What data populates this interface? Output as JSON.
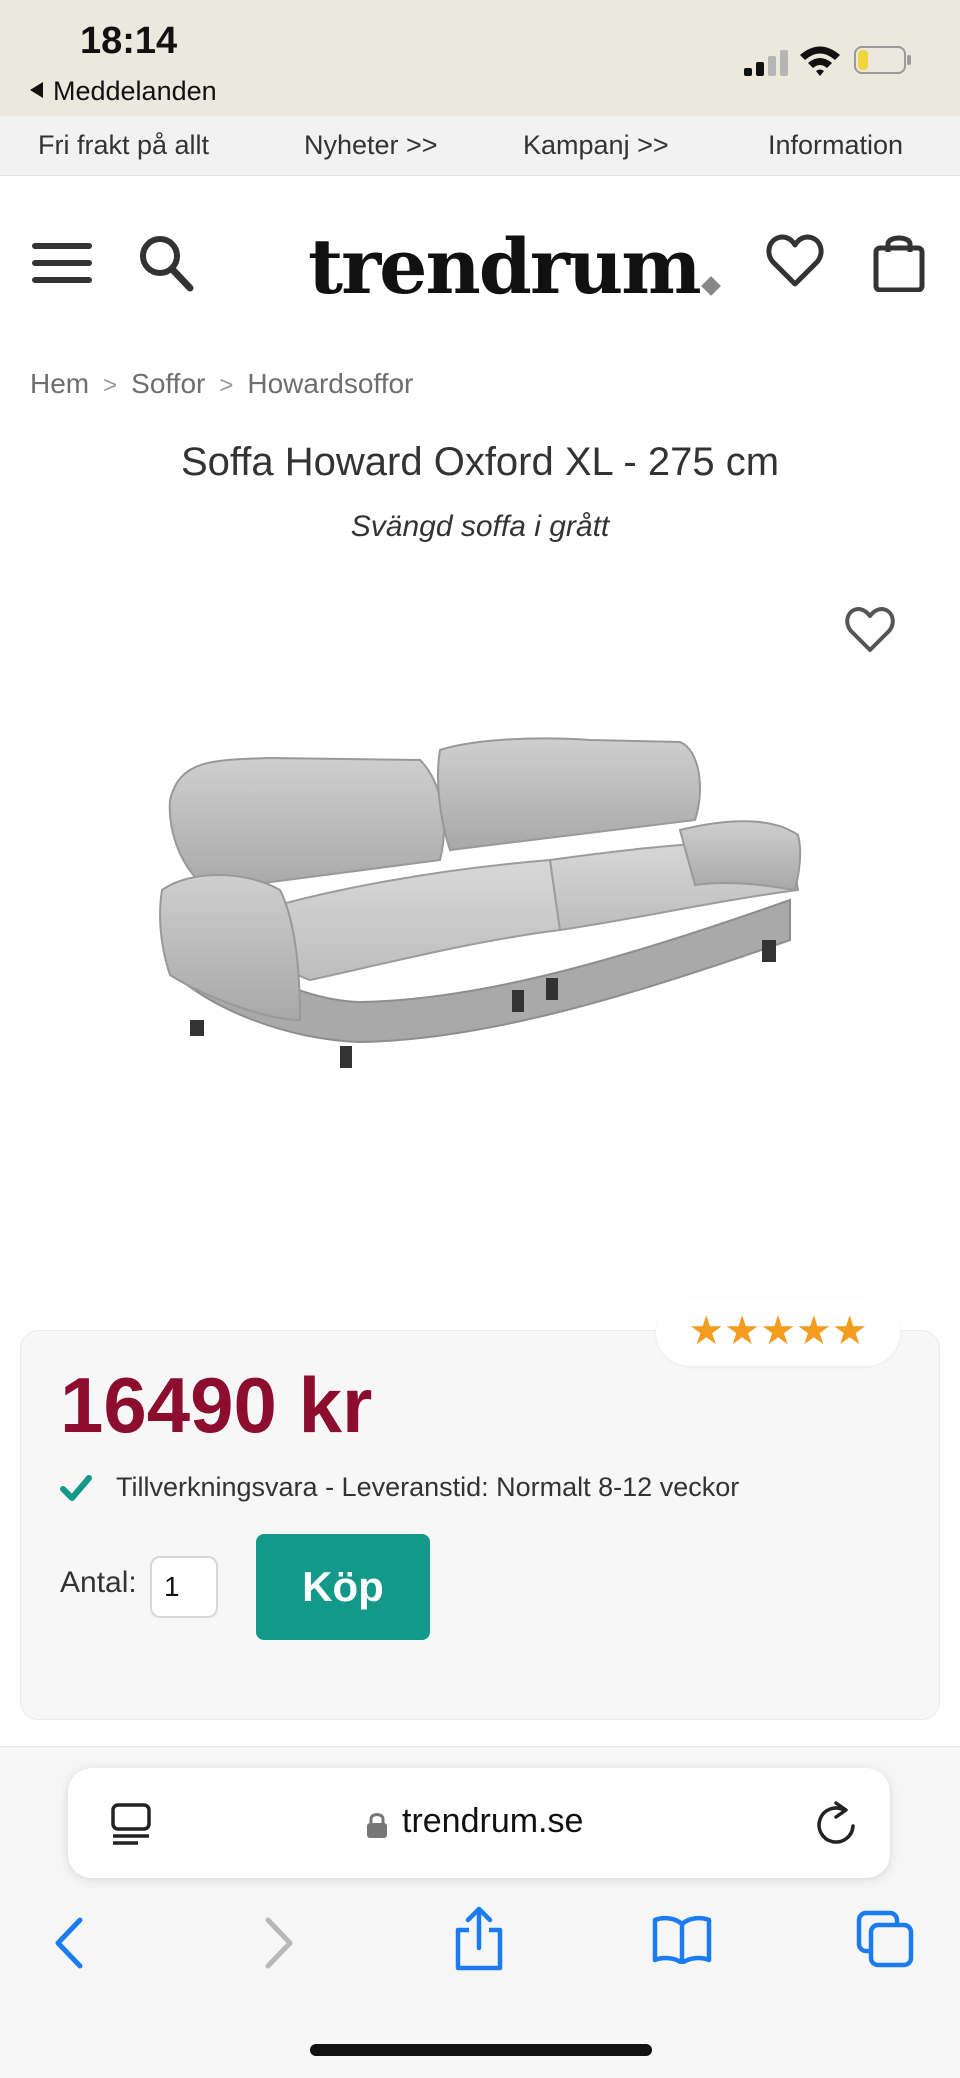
{
  "status_bar": {
    "time": "18:14",
    "back_app": "Meddelanden",
    "battery_color": "#f2d43d"
  },
  "promo_nav": {
    "items": [
      "Fri frakt på allt",
      "Nyheter >>",
      "Kampanj >>",
      "Information"
    ]
  },
  "header": {
    "logo": "trendrum",
    "icons": [
      "menu-icon",
      "search-icon",
      "heart-icon",
      "shopping-bag-icon"
    ]
  },
  "breadcrumb": [
    "Hem",
    "Soffor",
    "Howardsoffor"
  ],
  "product": {
    "title": "Soffa Howard Oxford XL - 275 cm",
    "subtitle": "Svängd soffa i grått",
    "rating_stars": 5,
    "rating_display": "★★★★★",
    "price": "16490 kr",
    "delivery_text": "Tillverkningsvara - Leveranstid: Normalt 8-12 veckor",
    "qty_label": "Antal:",
    "qty_value": "1",
    "buy_label": "Köp"
  },
  "colors": {
    "price": "#8c0d2e",
    "buy_button": "#12998a",
    "check": "#12998a",
    "stars": "#f39c1e",
    "safari_accent": "#1a7cf0"
  },
  "browser": {
    "url": "trendrum.se",
    "icons": [
      "reader-icon",
      "lock-icon",
      "reload-icon",
      "back-arrow-icon",
      "forward-arrow-icon",
      "share-icon",
      "bookmarks-icon",
      "tabs-icon"
    ]
  }
}
